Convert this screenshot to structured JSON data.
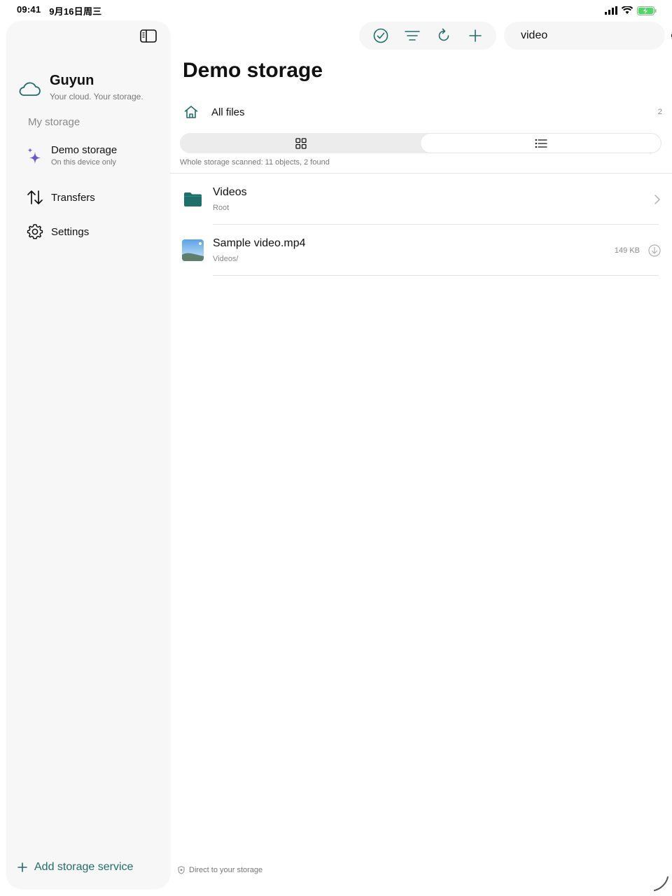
{
  "status_bar": {
    "time": "09:41",
    "date": "9月16日周三"
  },
  "sidebar": {
    "brand_title": "Guyun",
    "brand_subtitle": "Your cloud. Your storage.",
    "section_label": "My storage",
    "items": [
      {
        "label": "Demo storage",
        "sublabel": "On this device only",
        "icon": "sparkles-icon"
      },
      {
        "label": "Transfers",
        "icon": "arrows-up-down-icon"
      },
      {
        "label": "Settings",
        "icon": "gear-icon"
      }
    ],
    "add_storage_label": "Add storage service"
  },
  "toolbar": {
    "icons": [
      "checkmark-circle-icon",
      "filter-lines-icon",
      "refresh-icon",
      "plus-icon"
    ]
  },
  "search": {
    "value": "video",
    "placeholder": ""
  },
  "main": {
    "title": "Demo storage",
    "all_files_label": "All files",
    "all_files_count": "2",
    "view_modes": [
      "grid",
      "list"
    ],
    "active_view": "list",
    "scan_info": "Whole storage scanned: 11 objects, 2 found",
    "rows": [
      {
        "name": "Videos",
        "sub": "Root",
        "type": "folder"
      },
      {
        "name": "Sample video.mp4",
        "sub": "Videos/",
        "size": "149 KB",
        "type": "video"
      }
    ],
    "footer_note": "Direct to your storage"
  },
  "colors": {
    "accent": "#1f6f6a",
    "sparkle": "#6e56cf",
    "folder": "#1f6f6a"
  }
}
